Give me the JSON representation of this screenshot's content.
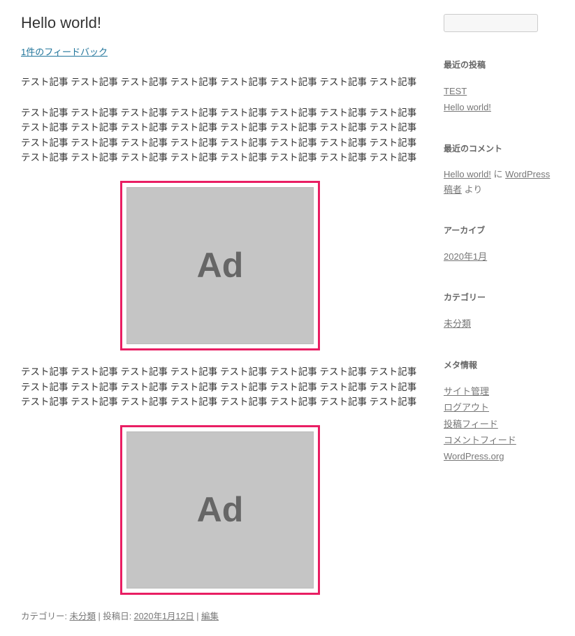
{
  "post": {
    "title": "Hello world!",
    "comments_link": "1件のフィードバック",
    "paragraph1": "テスト記事 テスト記事 テスト記事 テスト記事 テスト記事 テスト記事 テスト記事 テスト記事",
    "paragraph2": "テスト記事 テスト記事 テスト記事 テスト記事 テスト記事 テスト記事 テスト記事 テスト記事 テスト記事 テスト記事 テスト記事 テスト記事 テスト記事 テスト記事 テスト記事 テスト記事 テスト記事 テスト記事 テスト記事 テスト記事 テスト記事 テスト記事 テスト記事 テスト記事 テスト記事 テスト記事 テスト記事 テスト記事 テスト記事 テスト記事 テスト記事 テスト記事",
    "paragraph3": "テスト記事 テスト記事 テスト記事 テスト記事 テスト記事 テスト記事 テスト記事 テスト記事 テスト記事 テスト記事 テスト記事 テスト記事 テスト記事 テスト記事 テスト記事 テスト記事 テスト記事 テスト記事 テスト記事 テスト記事 テスト記事 テスト記事 テスト記事 テスト記事",
    "ad_label": "Ad",
    "meta": {
      "category_label": "カテゴリー: ",
      "category": "未分類",
      "date_label": "投稿日: ",
      "date": "2020年1月12日",
      "edit_label": "編集"
    }
  },
  "sidebar": {
    "search_placeholder": "",
    "recent_posts": {
      "title": "最近の投稿",
      "items": [
        "TEST",
        "Hello world!"
      ]
    },
    "recent_comments": {
      "title": "最近のコメント",
      "link1": "Hello world!",
      "mid_text": " に ",
      "link2": "WordPress 稿者",
      "suffix": " より"
    },
    "archives": {
      "title": "アーカイブ",
      "items": [
        "2020年1月"
      ]
    },
    "categories": {
      "title": "カテゴリー",
      "items": [
        "未分類"
      ]
    },
    "meta": {
      "title": "メタ情報",
      "items": [
        "サイト管理",
        "ログアウト",
        "投稿フィード",
        "コメントフィード",
        "WordPress.org"
      ]
    }
  }
}
